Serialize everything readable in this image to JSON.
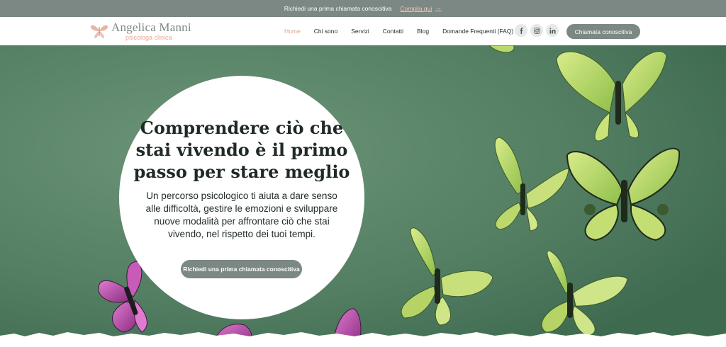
{
  "topbar": {
    "message": "Richiedi una prima chiamata conoscitiva",
    "link_label": "Compila qui",
    "link_arrow": "→"
  },
  "header": {
    "logo_name": "Angelica Manni",
    "logo_subtitle": "psicologa clinica",
    "nav": [
      {
        "label": "Home",
        "active": true
      },
      {
        "label": "Chi sono",
        "active": false
      },
      {
        "label": "Servizi",
        "active": false
      },
      {
        "label": "Contatti",
        "active": false
      },
      {
        "label": "Blog",
        "active": false
      },
      {
        "label": "Domande Frequenti (FAQ)",
        "active": false
      }
    ],
    "socials": [
      "facebook-icon",
      "instagram-icon",
      "linkedin-icon"
    ],
    "cta_label": "Chiamata conoscitiva"
  },
  "hero": {
    "headline": "Comprendere ciò che stai vivendo è il primo passo per stare meglio",
    "subtext": "Un percorso psicologico ti aiuta a dare senso alle difficoltà, gestire le emozioni e sviluppare nuove modalità per affrontare ciò che stai vivendo, nel rispetto dei tuoi tempi.",
    "cta_label": "Richiedi una prima chiamata conoscitiva",
    "background_image": "green-butterflies-on-green-background"
  },
  "colors": {
    "brand": "#7b8883",
    "accent": "#e0a38e",
    "hero_bg": "#4e7a5f",
    "butterfly_green": "#b8d96a",
    "butterfly_purple": "#a63e9a"
  }
}
